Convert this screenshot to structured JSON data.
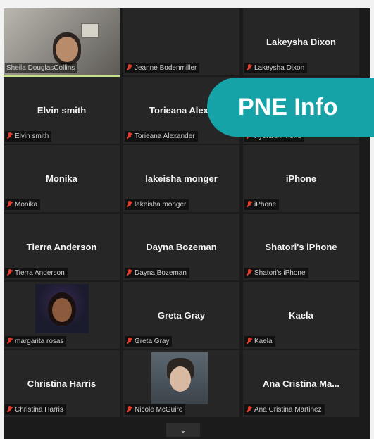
{
  "participants": [
    {
      "display_name": "",
      "nameplate": "Sheila DouglasCollins",
      "has_video": true,
      "video": "sheila",
      "muted": false,
      "active": true
    },
    {
      "display_name": "",
      "nameplate": "Jeanne Bodenmiller",
      "has_video": false,
      "muted": true
    },
    {
      "display_name": "Lakeysha Dixon",
      "nameplate": "Lakeysha Dixon",
      "has_video": false,
      "muted": true
    },
    {
      "display_name": "Elvin smith",
      "nameplate": "Elvin smith",
      "has_video": false,
      "muted": true
    },
    {
      "display_name": "Torieana Alexa",
      "nameplate": "Torieana Alexander",
      "has_video": false,
      "muted": true
    },
    {
      "display_name": "",
      "nameplate": "Kyara's iPhone",
      "has_video": false,
      "muted": true
    },
    {
      "display_name": "Monika",
      "nameplate": "Monika",
      "has_video": false,
      "muted": true
    },
    {
      "display_name": "lakeisha monger",
      "nameplate": "lakeisha monger",
      "has_video": false,
      "muted": true
    },
    {
      "display_name": "iPhone",
      "nameplate": "iPhone",
      "has_video": false,
      "muted": true
    },
    {
      "display_name": "Tierra Anderson",
      "nameplate": "Tierra Anderson",
      "has_video": false,
      "muted": true
    },
    {
      "display_name": "Dayna Bozeman",
      "nameplate": "Dayna Bozeman",
      "has_video": false,
      "muted": true
    },
    {
      "display_name": "Shatori's iPhone",
      "nameplate": "Shatori's iPhone",
      "has_video": false,
      "muted": true
    },
    {
      "display_name": "",
      "nameplate": "margarita rosas",
      "has_video": true,
      "video": "margarita",
      "muted": true
    },
    {
      "display_name": "Greta Gray",
      "nameplate": "Greta Gray",
      "has_video": false,
      "muted": true
    },
    {
      "display_name": "Kaela",
      "nameplate": "Kaela",
      "has_video": false,
      "muted": true
    },
    {
      "display_name": "Christina Harris",
      "nameplate": "Christina Harris",
      "has_video": false,
      "muted": true
    },
    {
      "display_name": "",
      "nameplate": "Nicole McGuire",
      "has_video": true,
      "video": "nicole",
      "muted": true
    },
    {
      "display_name": "Ana Cristina Ma...",
      "nameplate": "Ana Cristina Martinez",
      "has_video": false,
      "muted": true
    }
  ],
  "banner": {
    "text": "PNE Info"
  },
  "scroll": {
    "icon": "chevron-down-icon",
    "glyph": "⌄"
  },
  "colors": {
    "tile_bg": "#262626",
    "active_border": "#c5e08a",
    "muted_mic": "#e23b2a",
    "banner": "#16a3a8"
  }
}
